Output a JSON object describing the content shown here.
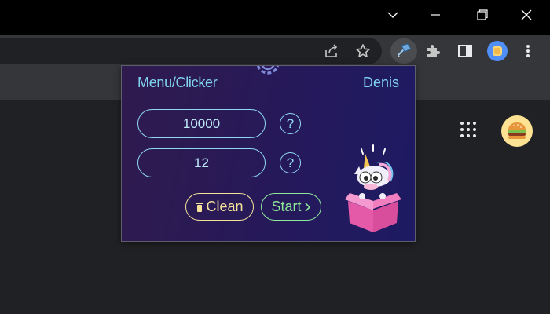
{
  "window": {
    "controls": [
      "chevron-down",
      "minimize",
      "restore",
      "close"
    ]
  },
  "toolbar": {
    "icons": [
      "share-icon",
      "star-icon",
      "extension-active-icon",
      "puzzle-icon",
      "sidepanel-icon",
      "profile-icon",
      "kebab-icon"
    ]
  },
  "page": {
    "apps_icon": "apps-grid-icon",
    "avatar_icon": "burger-avatar"
  },
  "popup": {
    "title": "Menu/Clicker",
    "user": "Denis",
    "field1": {
      "value": "10000",
      "help": "?"
    },
    "field2": {
      "value": "12",
      "help": "?"
    },
    "clean_label": "Clean",
    "start_label": "Start",
    "colors": {
      "accent": "#7fd3ef",
      "clean": "#f5e29a",
      "start": "#8ee89a",
      "bg_start": "#2f1a4d",
      "bg_end": "#1d1a63"
    }
  }
}
